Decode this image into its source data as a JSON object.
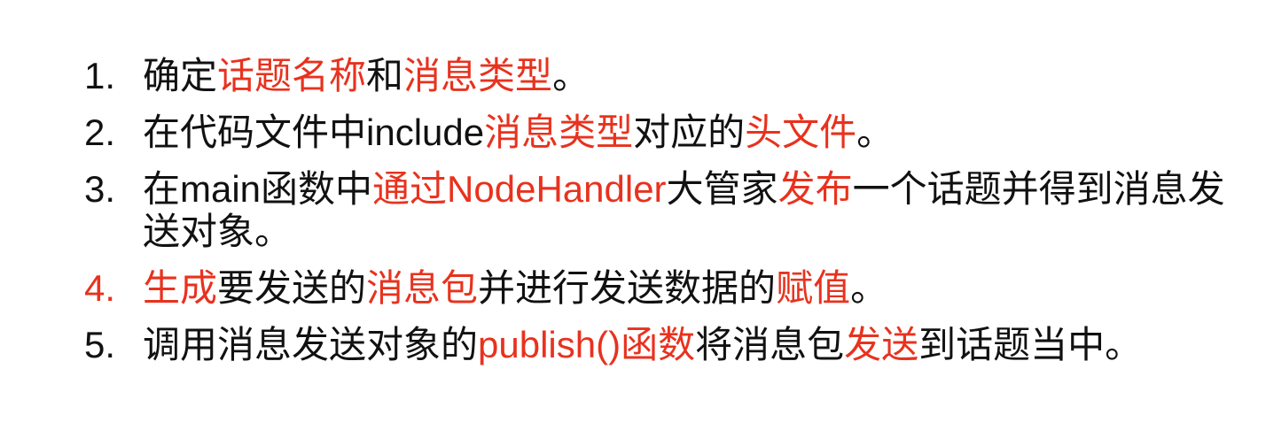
{
  "accent_color": "#e8321e",
  "items": [
    {
      "number": "1.",
      "highlight_number": false,
      "segments": [
        {
          "text": "确定",
          "red": false
        },
        {
          "text": "话题名称",
          "red": true
        },
        {
          "text": "和",
          "red": false
        },
        {
          "text": "消息类型",
          "red": true
        },
        {
          "text": "。",
          "red": false
        }
      ]
    },
    {
      "number": "2.",
      "highlight_number": false,
      "segments": [
        {
          "text": "在代码文件中include",
          "red": false
        },
        {
          "text": "消息类型",
          "red": true
        },
        {
          "text": "对应的",
          "red": false
        },
        {
          "text": "头文件",
          "red": true
        },
        {
          "text": "。",
          "red": false
        }
      ]
    },
    {
      "number": "3.",
      "highlight_number": false,
      "segments": [
        {
          "text": "在main函数中",
          "red": false
        },
        {
          "text": "通过NodeHandler",
          "red": true
        },
        {
          "text": "大管家",
          "red": false
        },
        {
          "text": "发布",
          "red": true
        },
        {
          "text": "一个话题并得到消息发送对象。",
          "red": false
        }
      ]
    },
    {
      "number": "4.",
      "highlight_number": true,
      "segments": [
        {
          "text": "生成",
          "red": true
        },
        {
          "text": "要发送的",
          "red": false
        },
        {
          "text": "消息包",
          "red": true
        },
        {
          "text": "并进行发送数据的",
          "red": false
        },
        {
          "text": "赋值",
          "red": true
        },
        {
          "text": "。",
          "red": false
        }
      ]
    },
    {
      "number": "5.",
      "highlight_number": false,
      "segments": [
        {
          "text": "调用消息发送对象的",
          "red": false
        },
        {
          "text": "publish()函数",
          "red": true
        },
        {
          "text": "将消息包",
          "red": false
        },
        {
          "text": "发送",
          "red": true
        },
        {
          "text": "到话题当中。",
          "red": false
        }
      ]
    }
  ]
}
